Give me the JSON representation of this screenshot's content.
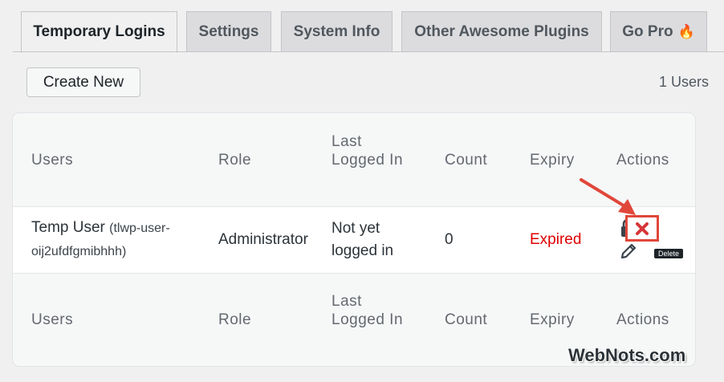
{
  "tabs": [
    {
      "label": "Temporary Logins",
      "active": true
    },
    {
      "label": "Settings",
      "active": false
    },
    {
      "label": "System Info",
      "active": false
    },
    {
      "label": "Other Awesome Plugins",
      "active": false
    },
    {
      "label": "Go Pro",
      "active": false,
      "icon": "fire-icon"
    }
  ],
  "toolbar": {
    "create_label": "Create New",
    "count_text": "1 Users"
  },
  "table": {
    "headers": [
      "Users",
      "Role",
      "Last Logged In",
      "Count",
      "Expiry",
      "Actions"
    ],
    "rows": [
      {
        "user_name": "Temp User",
        "username": "(tlwp-user-oij2ufdfgmibhhh)",
        "role": "Administrator",
        "last_login": "Not yet logged in",
        "count": "0",
        "expiry": "Expired",
        "actions": [
          "lock-icon",
          "delete-icon",
          "edit-icon"
        ]
      }
    ]
  },
  "tooltip": "Delete",
  "watermark": "WebNots.com",
  "colors": {
    "expired": "#e00000",
    "highlight": "#e0473a",
    "delete_icon": "#d63638"
  }
}
